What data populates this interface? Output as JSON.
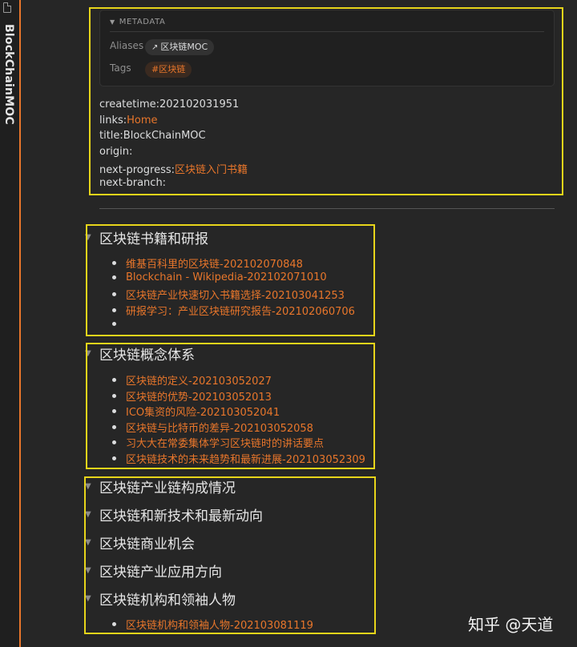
{
  "tab": {
    "title": "BlockChainMOC",
    "icon": "file-icon"
  },
  "metadata": {
    "header": "METADATA",
    "aliases_label": "Aliases",
    "alias_value": "区块链MOC",
    "tags_label": "Tags",
    "tag_value": "#区块链"
  },
  "frontmatter": {
    "createtime": "createtime:202102031951",
    "links_key": "links:",
    "links_value": "Home",
    "title": "title:BlockChainMOC",
    "origin": "origin:",
    "next_progress_key": "next-progress:",
    "next_progress_value": "区块链入门书籍",
    "next_branch": "next-branch:"
  },
  "sections": [
    {
      "heading": "区块链书籍和研报",
      "items": [
        "维基百科里的区块链-202102070848",
        "Blockchain - Wikipedia-202102071010",
        "区块链产业快速切入书籍选择-202103041253",
        "研报学习：产业区块链研究报告-202102060706",
        ""
      ]
    },
    {
      "heading": "区块链概念体系",
      "items": [
        "区块链的定义-202103052027",
        "区块链的优势-202103052013",
        "ICO集资的风险-202103052041",
        "区块链与比特币的差异-202103052058",
        "习大大在常委集体学习区块链时的讲话要点",
        "区块链技术的未来趋势和最新进展-202103052309"
      ]
    },
    {
      "heading": "区块链产业链构成情况",
      "items": []
    },
    {
      "heading": "区块链和新技术和最新动向",
      "items": []
    },
    {
      "heading": "区块链商业机会",
      "items": []
    },
    {
      "heading": "区块链产业应用方向",
      "items": []
    },
    {
      "heading": "区块链机构和领袖人物",
      "items": [
        "区块链机构和领袖人物-202103081119"
      ]
    }
  ],
  "watermark": "知乎 @天道",
  "colors": {
    "accent": "#e8762b",
    "annotation": "#e8d51a",
    "background": "#262626"
  }
}
